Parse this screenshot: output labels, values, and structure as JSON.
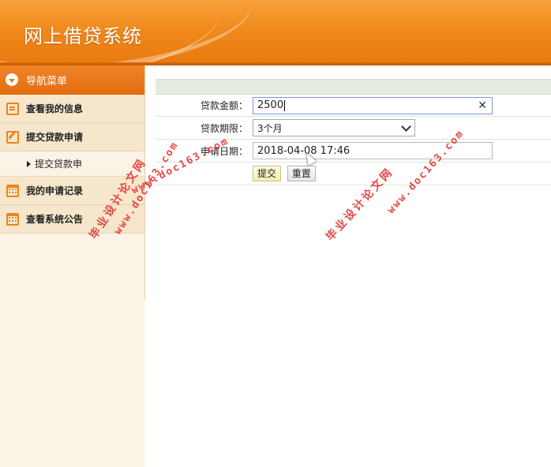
{
  "header": {
    "title": "网上借贷系统"
  },
  "sidebar": {
    "nav_title": "导航菜单",
    "items": [
      {
        "label": "查看我的信息",
        "icon": "message-icon"
      },
      {
        "label": "提交贷款申请",
        "icon": "edit-icon"
      },
      {
        "label": "提交贷款申",
        "icon": "none",
        "sub": true
      },
      {
        "label": "我的申请记录",
        "icon": "calendar-icon"
      },
      {
        "label": "查看系统公告",
        "icon": "calendar-icon"
      }
    ]
  },
  "form": {
    "amount_label": "贷款金额：",
    "amount_value": "2500",
    "term_label": "贷款期限：",
    "term_value": "3个月",
    "date_label": "申请日期：",
    "date_value": "2018-04-08 17:46",
    "submit_label": "提交",
    "reset_label": "重置"
  },
  "watermarks": {
    "text_cn": "毕业设计论文网",
    "url": "www.doc163.com"
  },
  "colors": {
    "header": "#f08a1c",
    "accent": "#e8861e",
    "sidebar_bg": "#f6ead8"
  }
}
